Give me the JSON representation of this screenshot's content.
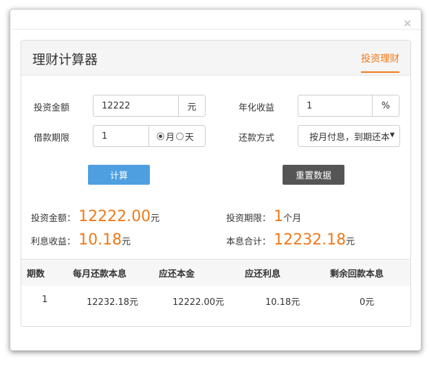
{
  "window": {
    "close_glyph": "×"
  },
  "panel": {
    "title": "理财计算器",
    "tab": "投资理财"
  },
  "form": {
    "amount": {
      "label": "投资金额",
      "value": "12222",
      "unit": "元"
    },
    "rate": {
      "label": "年化收益",
      "value": "1",
      "unit": "%"
    },
    "term": {
      "label": "借款期限",
      "value": "1",
      "options": [
        {
          "label": "月",
          "selected": true
        },
        {
          "label": "天",
          "selected": false
        }
      ]
    },
    "repay": {
      "label": "还款方式",
      "selected": "按月付息，到期还本"
    }
  },
  "buttons": {
    "calc": "计算",
    "reset": "重置数据"
  },
  "results": {
    "amount": {
      "label": "投资金额：",
      "value": "12222.00",
      "unit": "元"
    },
    "period": {
      "label": "投资期限：",
      "value": "1",
      "unit": "个月"
    },
    "interest": {
      "label": "利息收益：",
      "value": "10.18",
      "unit": "元"
    },
    "total": {
      "label": "本息合计：",
      "value": "12232.18",
      "unit": "元"
    }
  },
  "table": {
    "headers": [
      "期数",
      "每月还款本息",
      "应还本金",
      "应还利息",
      "剩余回款本息"
    ],
    "rows": [
      [
        "1",
        "12232.18元",
        "12222.00元",
        "10.18元",
        "0元"
      ]
    ]
  },
  "colors": {
    "accent": "#f07818",
    "calc_button": "#4e9fe0",
    "reset_button": "#555555"
  }
}
